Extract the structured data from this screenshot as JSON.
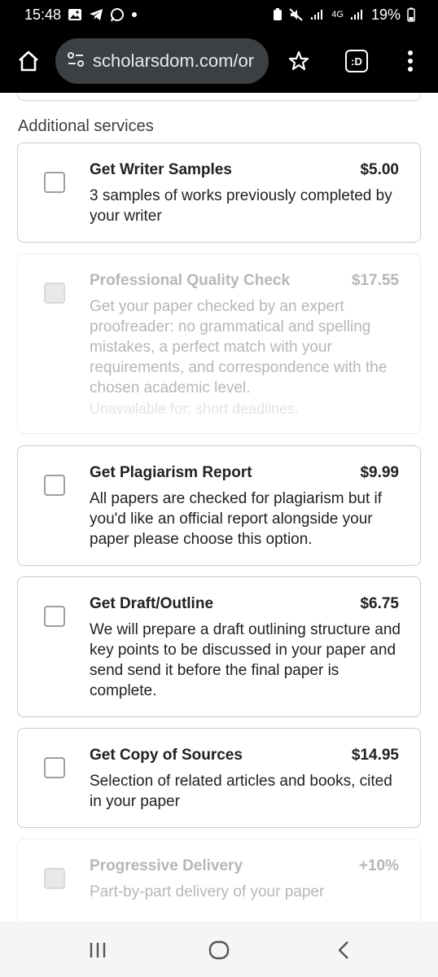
{
  "status": {
    "time": "15:48",
    "battery": "19%",
    "network": "4G"
  },
  "browser": {
    "url": "scholarsdom.com/or",
    "tabs_label": ":D",
    "icons": [
      "home-icon",
      "site-info-icon",
      "star-icon",
      "tabs-icon",
      "more-vert-icon"
    ]
  },
  "section_title": "Additional services",
  "services": [
    {
      "title": "Get Writer Samples",
      "price": "$5.00",
      "description": "3 samples of works previously completed by your writer",
      "disabled": false
    },
    {
      "title": "Professional Quality Check",
      "price": "$17.55",
      "description": "Get your paper checked by an expert proofreader: no grammatical and spelling mistakes, a perfect match with your requirements, and correspondence with the chosen academic level.",
      "note": "Unavailable for: short deadlines.",
      "disabled": true
    },
    {
      "title": "Get Plagiarism Report",
      "price": "$9.99",
      "description": "All papers are checked for plagiarism but if you'd like an official report alongside your paper please choose this option.",
      "disabled": false
    },
    {
      "title": "Get Draft/Outline",
      "price": "$6.75",
      "description": "We will prepare a draft outlining structure and key points to be discussed in your paper and send send it before the final paper is complete.",
      "disabled": false
    },
    {
      "title": "Get Copy of Sources",
      "price": "$14.95",
      "description": "Selection of related articles and books, cited in your paper",
      "disabled": false
    },
    {
      "title": "Progressive Delivery",
      "price": "+10%",
      "description": "Part-by-part delivery of your paper",
      "disabled": true
    }
  ],
  "colors": {
    "card_border": "#c8ccd2",
    "disabled_text": "#b4b7bb",
    "toolbar_bg": "#000000",
    "urlbar_bg": "#3c4043"
  }
}
